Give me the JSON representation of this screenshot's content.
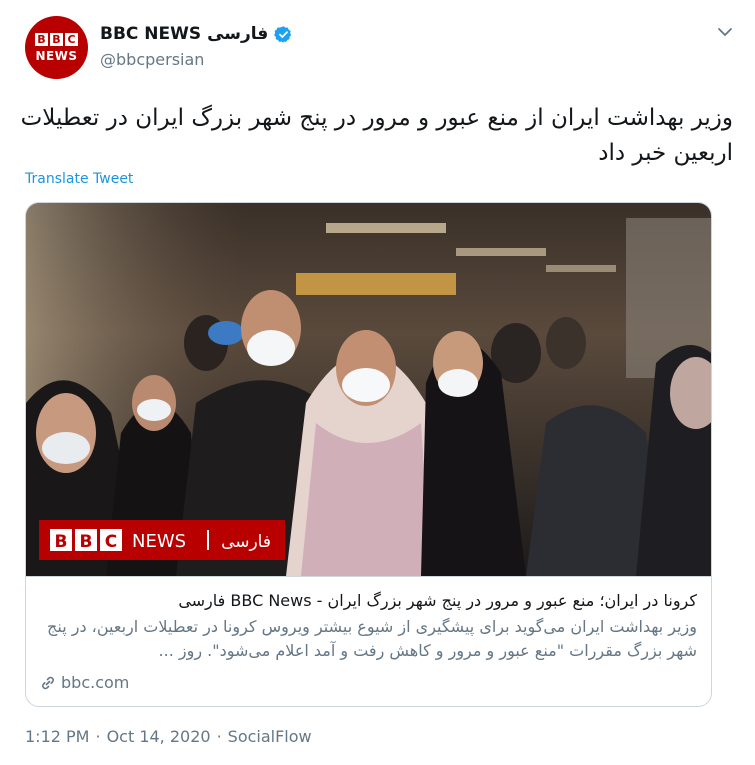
{
  "author": {
    "display_name": "BBC NEWS فارسی",
    "handle": "@bbcpersian",
    "avatar_text": "NEWS",
    "avatar_blocks": [
      "B",
      "B",
      "C"
    ],
    "verified_icon": "verified-badge-icon",
    "menu_icon": "chevron-down-icon"
  },
  "tweet": {
    "text": "وزیر بهداشت ایران از منع عبور و مرور در پنج شهر بزرگ ایران در تعطیلات اربعین خبر داد",
    "translate_label": "Translate Tweet"
  },
  "card": {
    "image_overlay": {
      "bbc": "BBC",
      "news": "NEWS",
      "persian": "فارسی"
    },
    "title": "کرونا در ایران؛ منع عبور و مرور در پنج شهر بزرگ ایران - BBC News فارسی",
    "description": "وزیر بهداشت ایران می‌گوید برای پیشگیری از شیوع بیشتر ویروس کرونا در تعطیلات اربعین، در پنج شهر بزرگ مقررات \"منع عبور و مرور و کاهش رفت و آمد اعلام می‌شود\". روز ...",
    "domain": "bbc.com",
    "link_icon": "link-icon"
  },
  "footer": {
    "time": "1:12 PM",
    "separator1": "·",
    "date": "Oct 14, 2020",
    "separator2": "·",
    "source": "SocialFlow"
  },
  "colors": {
    "brand_red": "#b80000",
    "link_blue": "#1b95e0",
    "muted_gray": "#657786",
    "border": "#ccd6dd"
  }
}
